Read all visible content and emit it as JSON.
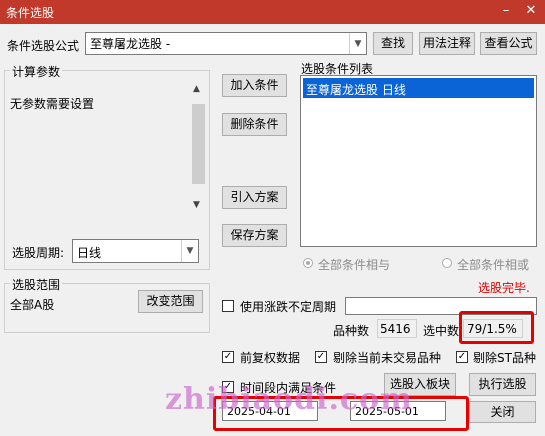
{
  "window": {
    "title": "条件选股",
    "min_icon": "minimize-icon",
    "close_icon": "close-icon"
  },
  "formula": {
    "label": "条件选股公式",
    "value": "至尊屠龙选股  -",
    "find_button": "查找",
    "usage_button": "用法注释",
    "view_button": "查看公式"
  },
  "params": {
    "group_title": "计算参数",
    "text": "无参数需要设置"
  },
  "period": {
    "label": "选股周期:",
    "value": "日线"
  },
  "actions": {
    "add": "加入条件",
    "delete": "删除条件",
    "import": "引入方案",
    "save": "保存方案"
  },
  "conditions": {
    "title": "选股条件列表",
    "items": [
      "至尊屠龙选股  日线"
    ]
  },
  "logic": {
    "and_label": "全部条件相与",
    "or_label": "全部条件相或"
  },
  "status": {
    "done_text": "选股完毕.",
    "done_color": "#e60000"
  },
  "range": {
    "group_title": "选股范围",
    "value": "全部A股",
    "change_button": "改变范围"
  },
  "uncertain_period": {
    "label": "使用涨跌不定周期",
    "checked": false
  },
  "stats": {
    "count_label": "品种数",
    "count_value": "5416",
    "selected_label": "选中数",
    "selected_value": "79/1.5%"
  },
  "options": [
    {
      "label": "前复权数据",
      "checked": true
    },
    {
      "label": "剔除当前未交易品种",
      "checked": true
    },
    {
      "label": "剔除ST品种",
      "checked": true
    }
  ],
  "time_range": {
    "label": "时间段内满足条件",
    "checked": true,
    "start": "2025-04-01",
    "end": "2025-05-01"
  },
  "bottom_buttons": {
    "to_block": "选股入板块",
    "execute": "执行选股",
    "close": "关闭"
  },
  "watermark": "zhibiaodi.com",
  "highlight_color": "#e60000"
}
